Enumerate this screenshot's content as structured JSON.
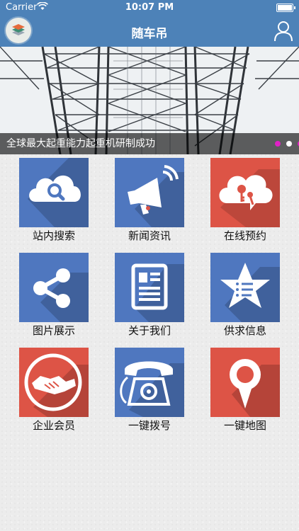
{
  "status_bar": {
    "carrier": "Carrier",
    "time": "10:07 PM"
  },
  "nav": {
    "title": "随车吊"
  },
  "banner": {
    "caption": "全球最大起重能力起重机研制成功",
    "dot_count": 3,
    "active_dot": 1
  },
  "colors": {
    "header": "#4d82b8",
    "tile_blue": "#4f77bf",
    "tile_red": "#dd5446",
    "dot_active": "#ffffff",
    "dot_inactive": "#e020c6"
  },
  "grid": {
    "items": [
      {
        "label": "站内搜索",
        "icon": "cloud-search-icon",
        "color": "blue"
      },
      {
        "label": "新闻资讯",
        "icon": "megaphone-icon",
        "color": "blue"
      },
      {
        "label": "在线预约",
        "icon": "cloud-keys-icon",
        "color": "red"
      },
      {
        "label": "图片展示",
        "icon": "share-icon",
        "color": "blue"
      },
      {
        "label": "关于我们",
        "icon": "document-icon",
        "color": "blue"
      },
      {
        "label": "供求信息",
        "icon": "star-list-icon",
        "color": "blue"
      },
      {
        "label": "企业会员",
        "icon": "handshake-icon",
        "color": "red"
      },
      {
        "label": "一键拨号",
        "icon": "telephone-icon",
        "color": "blue"
      },
      {
        "label": "一键地图",
        "icon": "map-pin-icon",
        "color": "red"
      }
    ]
  }
}
